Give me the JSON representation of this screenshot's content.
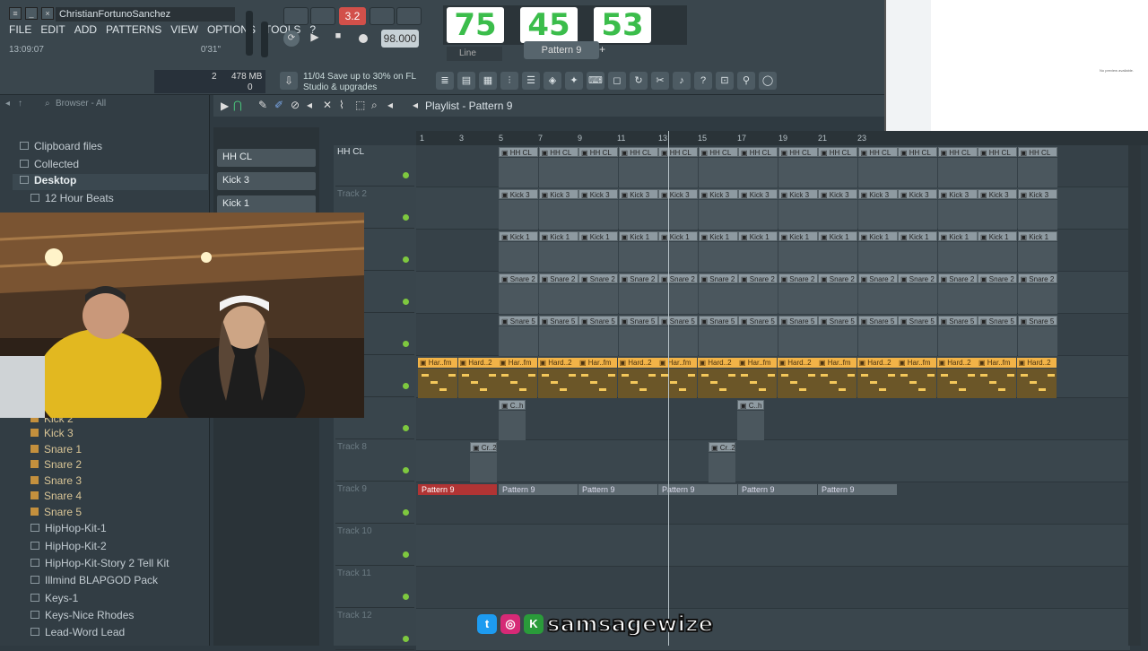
{
  "window": {
    "title": "ChristianFortunoSanchez",
    "time": "13:09:07",
    "time_right": "0'31\""
  },
  "menu": [
    "FILE",
    "EDIT",
    "ADD",
    "PATTERNS",
    "VIEW",
    "OPTIONS",
    "TOOLS",
    "?"
  ],
  "transport": {
    "tempo": "98.000",
    "pattern": "Pattern 9",
    "snap": "Line",
    "counter": "3.2"
  },
  "memory": {
    "value": "478 MB",
    "num": "2",
    "cpu": "0"
  },
  "news": {
    "line1": "11/04  Save up to 30% on FL",
    "line2": "Studio & upgrades"
  },
  "beats_overlay": [
    "75",
    "45",
    "53"
  ],
  "browser": {
    "header": "Browser - All",
    "items": [
      "Clipboard files",
      "Collected",
      "Desktop",
      "12 Hour Beats"
    ],
    "subitems": [
      "Kick 2",
      "Kick 3",
      "Snare 1",
      "Snare 2",
      "Snare 3",
      "Snare 4",
      "Snare 5"
    ],
    "folders": [
      "HipHop-Kit-1",
      "HipHop-Kit-2",
      "HipHop-Kit-Story 2 Tell Kit",
      "Illmind BLAPGOD Pack",
      "Keys-1",
      "Keys-Nice Rhodes",
      "Lead-Word Lead"
    ]
  },
  "channels": [
    "HH CL",
    "Kick 3",
    "Kick 1"
  ],
  "playlist": {
    "title": "Playlist - Pattern 9",
    "ruler": [
      "1",
      "3",
      "5",
      "7",
      "9",
      "11",
      "13",
      "15",
      "17",
      "19",
      "21",
      "23"
    ],
    "tracks": [
      "HH CL",
      "Track 2",
      "",
      "",
      "",
      "",
      "",
      "Track 8",
      "Track 9",
      "Track 10",
      "Track 11",
      "Track 12"
    ],
    "clip_labels": {
      "hh": "HH CL",
      "kick3": "Kick 3",
      "kick1": "Kick 1",
      "snare2": "Snare 2",
      "snare5": "Snare 5",
      "hard1": "Har..fm",
      "hard2": "Hard..2",
      "pat9": "Pattern 9",
      "crash": "Cr..2",
      "chh": "C..h"
    }
  },
  "social": {
    "handle": "samsagewize",
    "icons": [
      "twitter-icon",
      "instagram-icon",
      "kick-icon"
    ]
  },
  "thumb": {
    "message": "No preview available."
  },
  "colors": {
    "accent_green": "#3bbd4b",
    "clip_gold": "#f2b347",
    "clip_red": "#b13434"
  }
}
